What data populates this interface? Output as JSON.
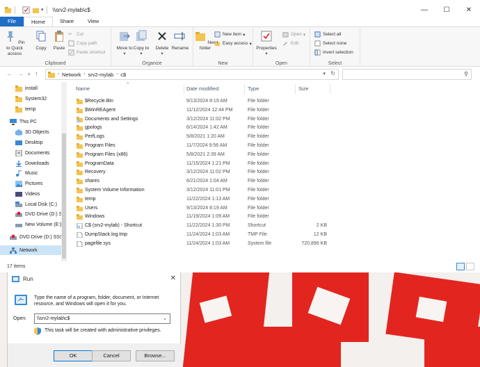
{
  "explorer": {
    "title": "\\\\srv2-mylab\\c$",
    "window_controls": [
      "minimize",
      "maximize",
      "close"
    ],
    "tabs": [
      {
        "label": "File"
      },
      {
        "label": "Home"
      },
      {
        "label": "Share"
      },
      {
        "label": "View"
      }
    ],
    "ribbon": {
      "clipboard": {
        "group_label": "Clipboard",
        "pin_label": "Pin to Quick access",
        "copy_label": "Copy",
        "paste_label": "Paste",
        "cut_label": "Cut",
        "copy_path_label": "Copy path",
        "paste_shortcut_label": "Paste shortcut"
      },
      "organize": {
        "group_label": "Organize",
        "move_to_label": "Move to",
        "copy_to_label": "Copy to",
        "delete_label": "Delete",
        "rename_label": "Rename"
      },
      "new": {
        "group_label": "New",
        "new_folder_label": "New folder",
        "new_item_label": "New item",
        "easy_access_label": "Easy access"
      },
      "open": {
        "group_label": "Open",
        "properties_label": "Properties",
        "open_label": "Open",
        "edit_label": "Edit"
      },
      "select": {
        "group_label": "Select",
        "select_all_label": "Select all",
        "select_none_label": "Select none",
        "invert_label": "Invert selection"
      }
    },
    "address": {
      "crumbs": [
        "Network",
        "srv2-mylab",
        "c$"
      ]
    },
    "nav": [
      {
        "label": "install",
        "icon": "folder-icon"
      },
      {
        "label": "System32",
        "icon": "folder-icon"
      },
      {
        "label": "temp",
        "icon": "folder-icon"
      },
      {
        "label": "This PC",
        "icon": "computer-icon"
      },
      {
        "label": "3D Objects",
        "icon": "3d-objects-icon"
      },
      {
        "label": "Desktop",
        "icon": "desktop-icon"
      },
      {
        "label": "Documents",
        "icon": "documents-icon"
      },
      {
        "label": "Downloads",
        "icon": "downloads-icon"
      },
      {
        "label": "Music",
        "icon": "music-icon"
      },
      {
        "label": "Pictures",
        "icon": "pictures-icon"
      },
      {
        "label": "Videos",
        "icon": "videos-icon"
      },
      {
        "label": "Local Disk (C:)",
        "icon": "disk-icon"
      },
      {
        "label": "DVD Drive (D:) SS",
        "icon": "dvd-icon"
      },
      {
        "label": "New Volume (E:)",
        "icon": "disk-icon"
      },
      {
        "label": "DVD Drive (D:) SSS",
        "icon": "dvd-icon"
      },
      {
        "label": "Network",
        "icon": "network-icon"
      }
    ],
    "columns": {
      "name": "Name",
      "date": "Date modified",
      "type": "Type",
      "size": "Size"
    },
    "files": [
      {
        "name": "$Recycle.Bin",
        "date": "9/13/2024 8:19 AM",
        "type": "File folder",
        "size": "",
        "icon": "folder-icon"
      },
      {
        "name": "$WinREAgent",
        "date": "11/12/2024 12:44 PM",
        "type": "File folder",
        "size": "",
        "icon": "folder-icon"
      },
      {
        "name": "Documents and Settings",
        "date": "3/12/2024 11:02 PM",
        "type": "File folder",
        "size": "",
        "icon": "folder-shortcut-icon"
      },
      {
        "name": "gpologs",
        "date": "6/14/2024 1:42 AM",
        "type": "File folder",
        "size": "",
        "icon": "folder-icon"
      },
      {
        "name": "PerfLogs",
        "date": "5/8/2021 1:20 AM",
        "type": "File folder",
        "size": "",
        "icon": "folder-icon"
      },
      {
        "name": "Program Files",
        "date": "11/7/2024 9:56 AM",
        "type": "File folder",
        "size": "",
        "icon": "folder-icon"
      },
      {
        "name": "Program Files (x86)",
        "date": "5/8/2021 2:39 AM",
        "type": "File folder",
        "size": "",
        "icon": "folder-icon"
      },
      {
        "name": "ProgramData",
        "date": "11/15/2024 1:21 PM",
        "type": "File folder",
        "size": "",
        "icon": "folder-icon"
      },
      {
        "name": "Recovery",
        "date": "3/12/2024 11:02 PM",
        "type": "File folder",
        "size": "",
        "icon": "folder-icon"
      },
      {
        "name": "shares",
        "date": "6/21/2024 1:04 AM",
        "type": "File folder",
        "size": "",
        "icon": "folder-icon"
      },
      {
        "name": "System Volume Information",
        "date": "3/12/2024 11:01 PM",
        "type": "File folder",
        "size": "",
        "icon": "folder-icon"
      },
      {
        "name": "temp",
        "date": "11/22/2024 1:13 AM",
        "type": "File folder",
        "size": "",
        "icon": "folder-icon"
      },
      {
        "name": "Users",
        "date": "9/13/2024 8:19 AM",
        "type": "File folder",
        "size": "",
        "icon": "folder-icon"
      },
      {
        "name": "Windows",
        "date": "11/19/2024 1:09 AM",
        "type": "File folder",
        "size": "",
        "icon": "folder-icon"
      },
      {
        "name": "C$ (srv2-mylab) - Shortcut",
        "date": "11/22/2024 1:30 PM",
        "type": "Shortcut",
        "size": "2 KB",
        "icon": "shortcut-icon"
      },
      {
        "name": "DumpStack.log.tmp",
        "date": "11/24/2024 1:03 AM",
        "type": "TMP File",
        "size": "12 KB",
        "icon": "file-icon"
      },
      {
        "name": "pagefile.sys",
        "date": "11/24/2024 1:03 AM",
        "type": "System file",
        "size": "720,896 KB",
        "icon": "file-icon"
      }
    ],
    "status": {
      "item_count": "17 items"
    }
  },
  "run_dialog": {
    "title": "Run",
    "description": "Type the name of a program, folder, document, or Internet resource, and Windows will open it for you.",
    "open_label": "Open:",
    "open_value": "\\\\srv2-mylab\\c$",
    "admin_note": "This task will be created with administrative privileges.",
    "ok_label": "OK",
    "cancel_label": "Cancel",
    "browse_label": "Browse..."
  },
  "colors": {
    "accent": "#1e6ec8",
    "folder": "#f3c451",
    "background_red": "#e3251f",
    "selection": "#cce4f7"
  }
}
